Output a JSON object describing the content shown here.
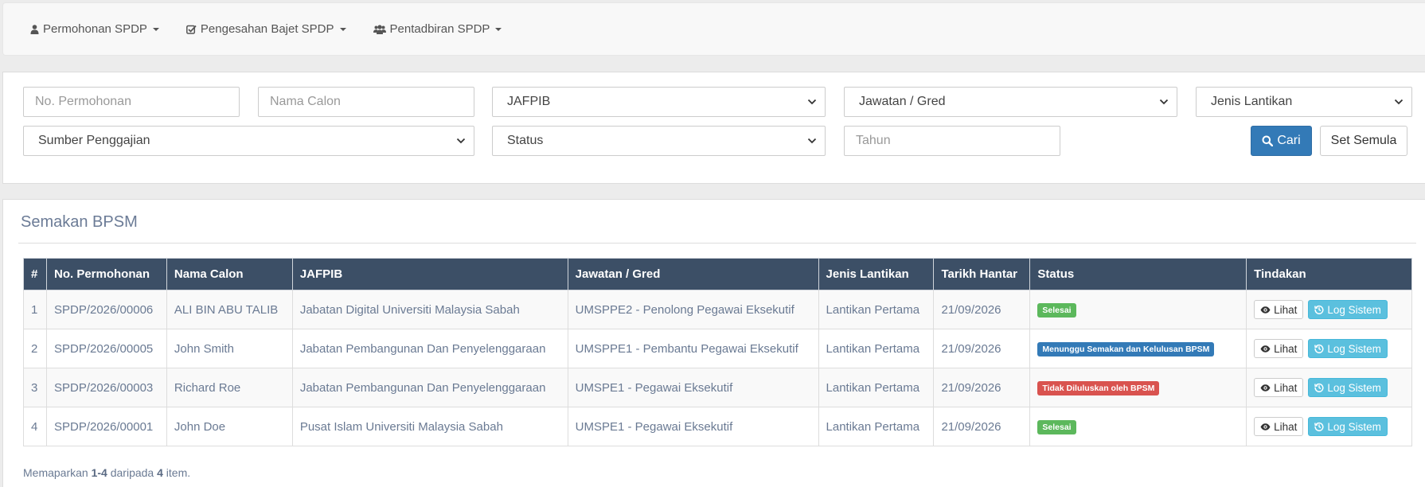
{
  "navbar": {
    "items": [
      {
        "label": "Permohonan SPDP",
        "icon": "user-icon"
      },
      {
        "label": "Pengesahan Bajet SPDP",
        "icon": "check-square-icon"
      },
      {
        "label": "Pentadbiran SPDP",
        "icon": "users-icon"
      }
    ]
  },
  "filters": {
    "no_permohonan_placeholder": "No. Permohonan",
    "nama_calon_placeholder": "Nama Calon",
    "jafpib_selected": "JAFPIB",
    "jawatan_selected": "Jawatan / Gred",
    "jenis_lantikan_selected": "Jenis Lantikan",
    "sumber_penggajian_selected": "Sumber Penggajian",
    "status_selected": "Status",
    "tahun_placeholder": "Tahun",
    "search_label": "Cari",
    "reset_label": "Set Semula"
  },
  "results": {
    "title": "Semakan BPSM",
    "columns": [
      "#",
      "No. Permohonan",
      "Nama Calon",
      "JAFPIB",
      "Jawatan / Gred",
      "Jenis Lantikan",
      "Tarikh Hantar",
      "Status",
      "Tindakan"
    ],
    "rows": [
      {
        "num": "1",
        "no": "SPDP/2026/00006",
        "nama": "ALI BIN ABU TALIB",
        "jafpib": "Jabatan Digital Universiti Malaysia Sabah",
        "jawatan": "UMSPPE2 - Penolong Pegawai Eksekutif",
        "jenis": "Lantikan Pertama",
        "tarikh": "21/09/2026",
        "status": "Selesai",
        "status_color": "#5cb85c"
      },
      {
        "num": "2",
        "no": "SPDP/2026/00005",
        "nama": "John Smith",
        "jafpib": "Jabatan Pembangunan Dan Penyelenggaraan",
        "jawatan": "UMSPPE1 - Pembantu Pegawai Eksekutif",
        "jenis": "Lantikan Pertama",
        "tarikh": "21/09/2026",
        "status": "Menunggu Semakan dan Kelulusan BPSM",
        "status_color": "#337ab7"
      },
      {
        "num": "3",
        "no": "SPDP/2026/00003",
        "nama": "Richard Roe",
        "jafpib": "Jabatan Pembangunan Dan Penyelenggaraan",
        "jawatan": "UMSPE1 - Pegawai Eksekutif",
        "jenis": "Lantikan Pertama",
        "tarikh": "21/09/2026",
        "status": "Tidak Diluluskan oleh BPSM",
        "status_color": "#d9534f"
      },
      {
        "num": "4",
        "no": "SPDP/2026/00001",
        "nama": "John Doe",
        "jafpib": "Pusat Islam Universiti Malaysia Sabah",
        "jawatan": "UMSPE1 - Pegawai Eksekutif",
        "jenis": "Lantikan Pertama",
        "tarikh": "21/09/2026",
        "status": "Selesai",
        "status_color": "#5cb85c"
      }
    ],
    "view_label": "Lihat",
    "log_label": "Log Sistem"
  },
  "summary": {
    "prefix": "Memaparkan",
    "range": "1-4",
    "middle": "daripada",
    "total": "4",
    "suffix": "item."
  },
  "colors": {
    "header_bg": "#3c4f66",
    "primary": "#337ab7",
    "info": "#5bc0de",
    "success": "#5cb85c",
    "danger": "#d9534f"
  }
}
